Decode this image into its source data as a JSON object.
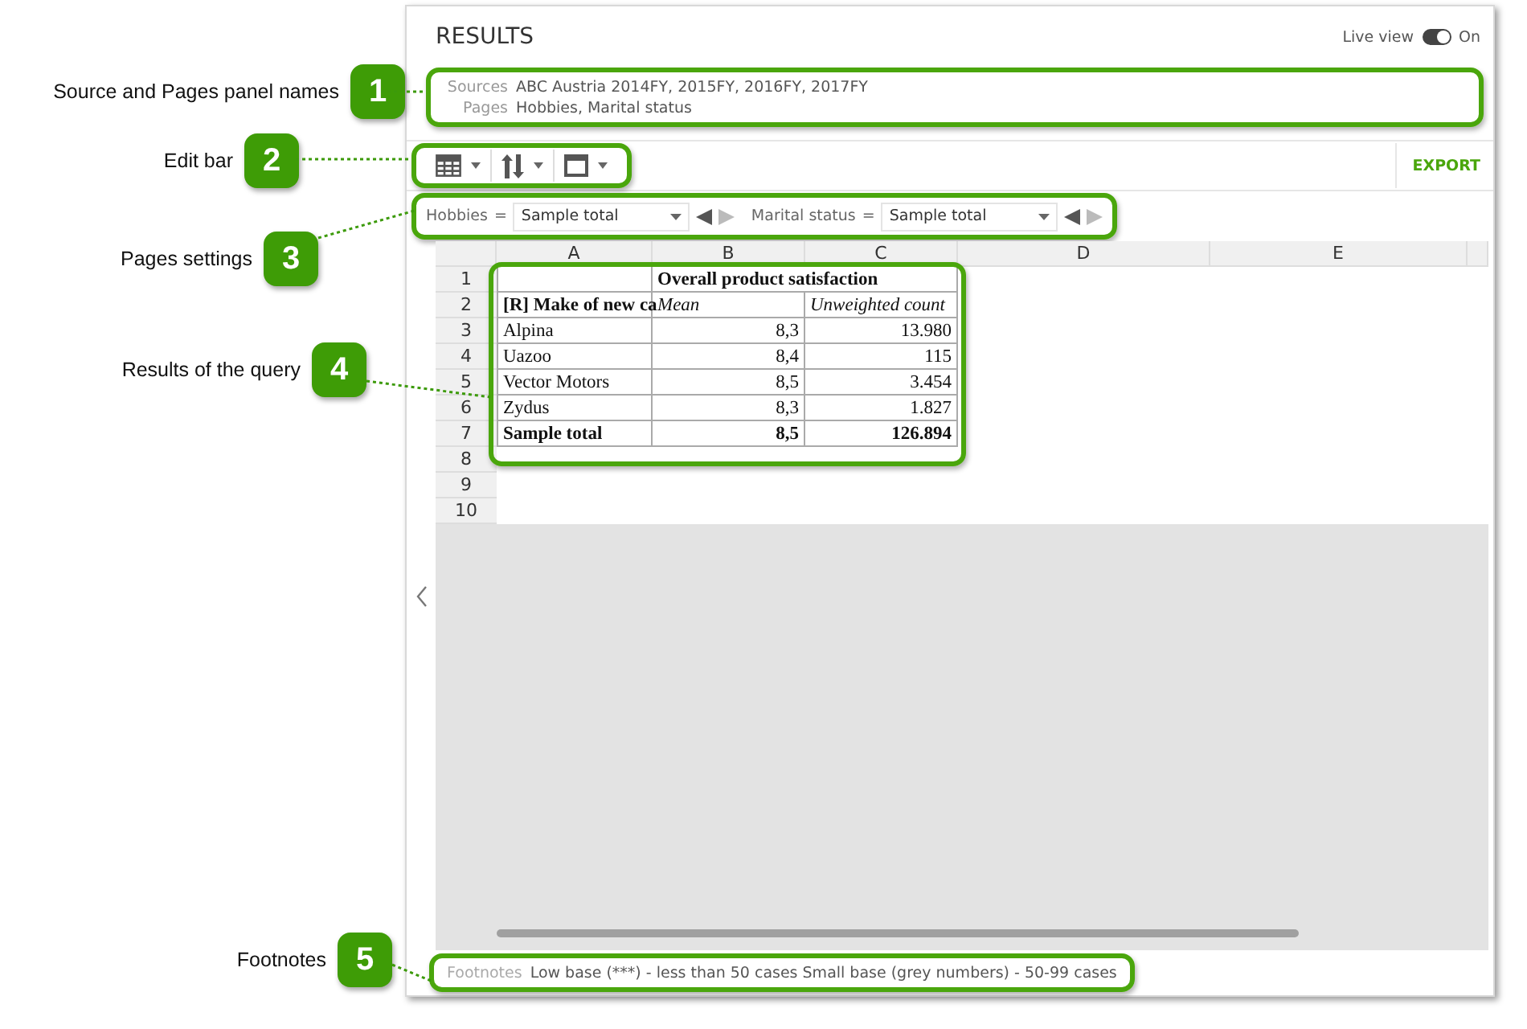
{
  "callouts": [
    {
      "number": "1",
      "label": "Source and Pages panel names"
    },
    {
      "number": "2",
      "label": "Edit bar"
    },
    {
      "number": "3",
      "label": "Pages settings"
    },
    {
      "number": "4",
      "label": "Results of the query"
    },
    {
      "number": "5",
      "label": "Footnotes"
    }
  ],
  "results": {
    "title": "RESULTS",
    "live_view": {
      "label": "Live view",
      "on": true,
      "state_text": "On"
    }
  },
  "info_panel": {
    "sources_label": "Sources",
    "sources_value": "ABC Austria 2014FY, 2015FY, 2016FY, 2017FY",
    "pages_label": "Pages",
    "pages_value": "Hobbies, Marital status"
  },
  "edit_bar": {
    "export": "EXPORT"
  },
  "pages_settings": [
    {
      "name": "Hobbies",
      "operator": "=",
      "value": "Sample total",
      "prev_disabled": false,
      "next_disabled": true
    },
    {
      "name": "Marital status",
      "operator": "=",
      "value": "Sample total",
      "prev_disabled": false,
      "next_disabled": true
    }
  ],
  "grid": {
    "columns": [
      "A",
      "B",
      "C",
      "D",
      "E"
    ],
    "row_numbers": [
      "1",
      "2",
      "3",
      "4",
      "5",
      "6",
      "7",
      "8",
      "9",
      "10"
    ],
    "rows": [
      [
        {
          "kind": "plain"
        },
        {
          "text": "Overall product satisfaction",
          "kind": "bold",
          "spans_next": true
        }
      ],
      [
        {
          "text": "[R] Make of new ca",
          "kind": "bold"
        },
        {
          "text": "Mean",
          "kind": "italic"
        },
        {
          "text": "Unweighted count",
          "kind": "italic"
        }
      ],
      [
        {
          "text": "Alpina",
          "kind": "plain"
        },
        {
          "text": "8,3",
          "kind": "number"
        },
        {
          "text": "13.980",
          "kind": "number"
        }
      ],
      [
        {
          "text": "Uazoo",
          "kind": "plain"
        },
        {
          "text": "8,4",
          "kind": "number"
        },
        {
          "text": "115",
          "kind": "number"
        }
      ],
      [
        {
          "text": "Vector Motors",
          "kind": "plain"
        },
        {
          "text": "8,5",
          "kind": "number"
        },
        {
          "text": "3.454",
          "kind": "number"
        }
      ],
      [
        {
          "text": "Zydus",
          "kind": "plain"
        },
        {
          "text": "8,3",
          "kind": "number"
        },
        {
          "text": "1.827",
          "kind": "number"
        }
      ],
      [
        {
          "text": "Sample total",
          "kind": "bold"
        },
        {
          "text": "8,5",
          "kind": "bold-number"
        },
        {
          "text": "126.894",
          "kind": "bold-number"
        }
      ]
    ]
  },
  "footnotes": {
    "label": "Footnotes",
    "text": "Low base (***) - less than 50 cases Small base (grey numbers) - 50-99 cases"
  }
}
